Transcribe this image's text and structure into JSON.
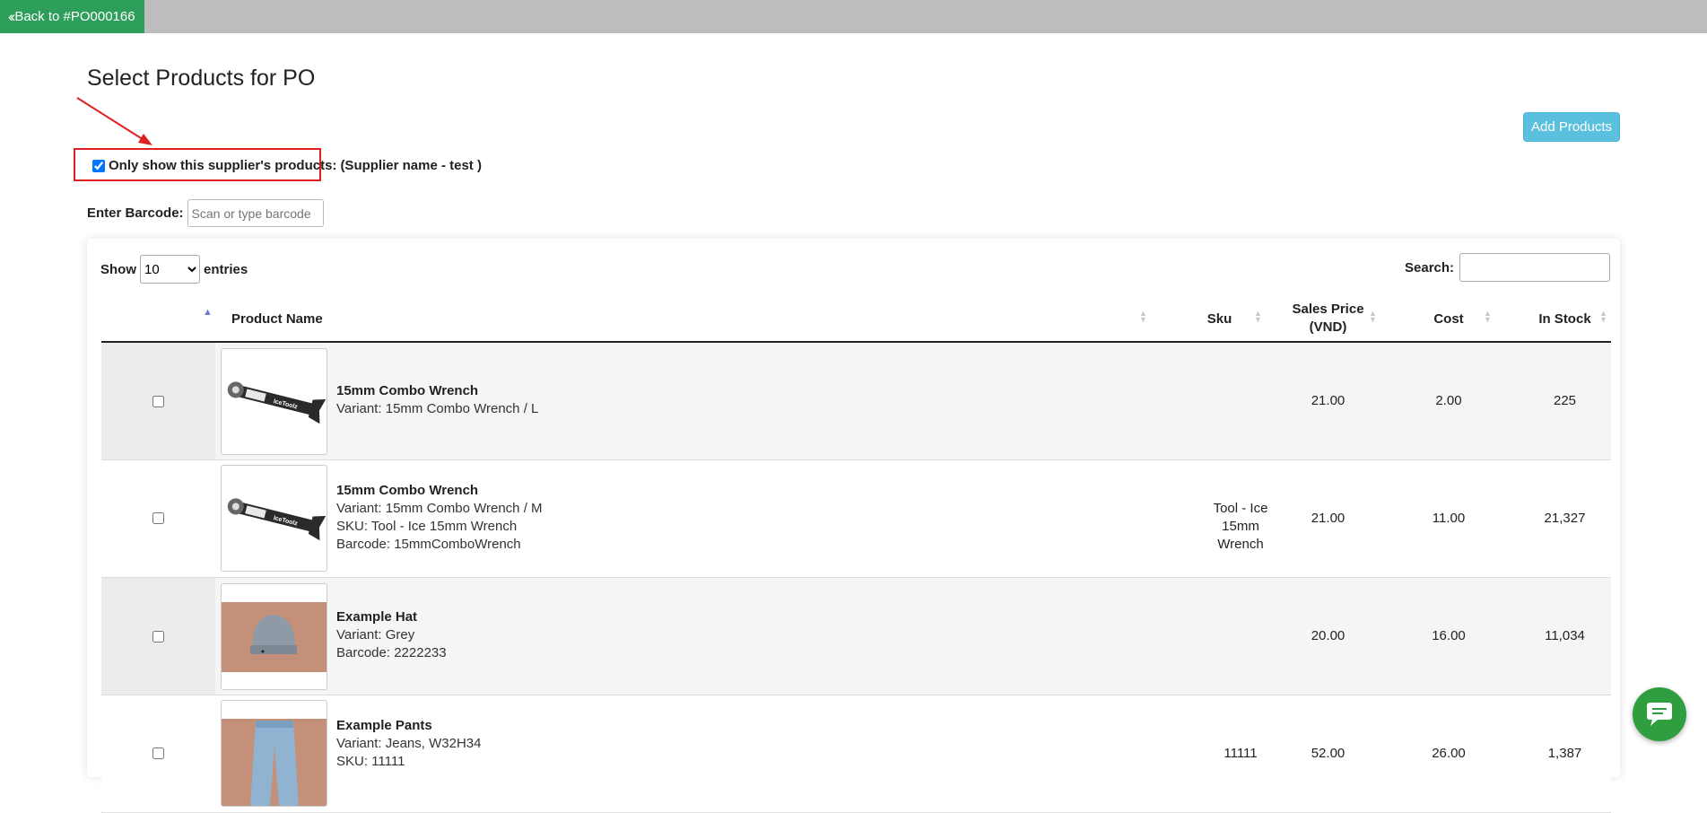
{
  "nav": {
    "back_label": "Back to #PO000166"
  },
  "page": {
    "title": "Select Products for PO",
    "add_products_label": "Add Products"
  },
  "filter": {
    "label": "Only show this supplier's products:",
    "supplier": "(Supplier name - test )",
    "checked": true
  },
  "barcode": {
    "label": "Enter Barcode:",
    "placeholder": "Scan or type barcode"
  },
  "table_controls": {
    "show_label": "Show",
    "entries_value": "10",
    "entries_label": "entries",
    "search_label": "Search:"
  },
  "columns": {
    "product_name": "Product Name",
    "sku": "Sku",
    "sales_price_line1": "Sales Price",
    "sales_price_line2": "(VND)",
    "cost": "Cost",
    "in_stock": "In Stock"
  },
  "rows": [
    {
      "name": "15mm Combo Wrench",
      "variant": "Variant: 15mm Combo Wrench / L",
      "sku_line": "",
      "barcode_line": "",
      "sku": "",
      "sku_line2": "",
      "sales_price": "21.00",
      "cost": "2.00",
      "in_stock": "225",
      "image": "wrench"
    },
    {
      "name": "15mm Combo Wrench",
      "variant": "Variant: 15mm Combo Wrench / M",
      "sku_line": "SKU: Tool - Ice 15mm Wrench",
      "barcode_line": "Barcode: 15mmComboWrench",
      "sku": "Tool - Ice 15mm",
      "sku_line2": "Wrench",
      "sales_price": "21.00",
      "cost": "11.00",
      "in_stock": "21,327",
      "image": "wrench"
    },
    {
      "name": "Example Hat",
      "variant": "Variant: Grey",
      "sku_line": "",
      "barcode_line": "Barcode: 2222233",
      "sku": "",
      "sku_line2": "",
      "sales_price": "20.00",
      "cost": "16.00",
      "in_stock": "11,034",
      "image": "hat"
    },
    {
      "name": "Example Pants",
      "variant": "Variant: Jeans, W32H34",
      "sku_line": "SKU: 11111",
      "barcode_line": "",
      "sku": "11111",
      "sku_line2": "",
      "sales_price": "52.00",
      "cost": "26.00",
      "in_stock": "1,387",
      "image": "pants"
    }
  ],
  "colors": {
    "back_green": "#2e9e5b",
    "add_blue": "#5bc0de",
    "highlight_red": "#e02020",
    "chat_green": "#2e9e3e",
    "topbar_grey": "#bdbdbd"
  }
}
